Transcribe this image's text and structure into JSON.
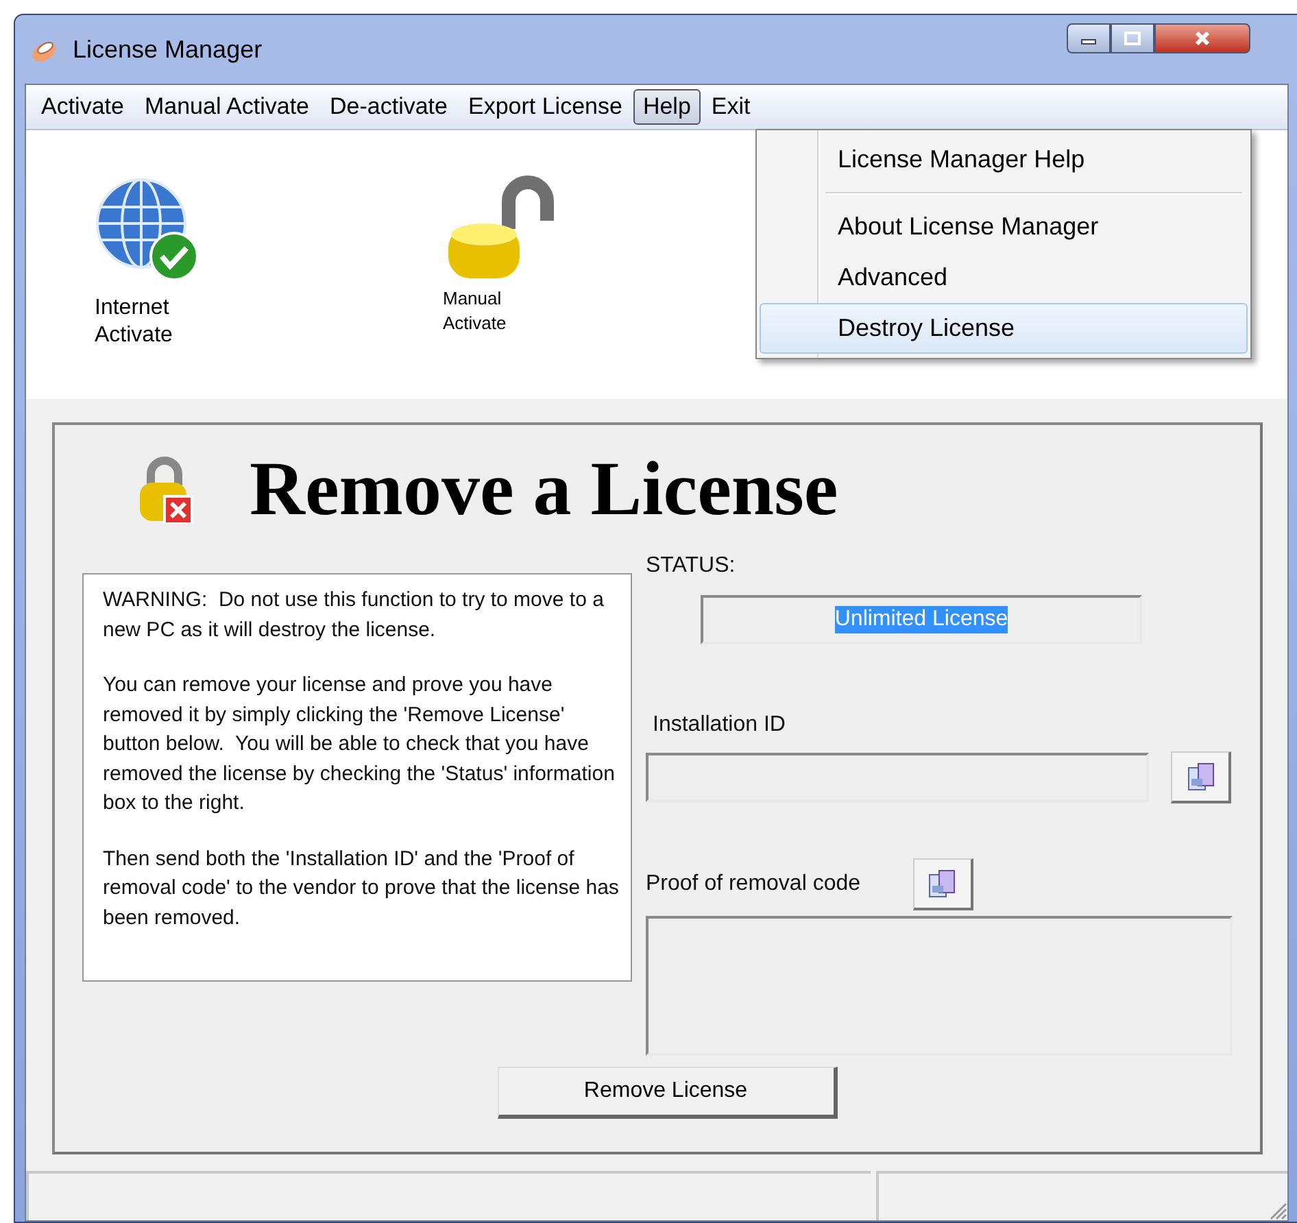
{
  "window": {
    "title": "License Manager"
  },
  "menu": [
    {
      "label": "Activate",
      "open": false
    },
    {
      "label": "Manual Activate",
      "open": false
    },
    {
      "label": "De-activate",
      "open": false
    },
    {
      "label": "Export License",
      "open": false
    },
    {
      "label": "Help",
      "open": true
    },
    {
      "label": "Exit",
      "open": false
    }
  ],
  "help_menu": [
    {
      "kind": "item",
      "label": "License Manager Help",
      "selected": false
    },
    {
      "kind": "separator"
    },
    {
      "kind": "item",
      "label": "About License Manager",
      "selected": false
    },
    {
      "kind": "item",
      "label": "Advanced",
      "selected": false
    },
    {
      "kind": "item",
      "label": "Destroy License",
      "selected": true
    }
  ],
  "toolbar": [
    {
      "kind": "globe",
      "label": "Internet Activate"
    },
    {
      "kind": "padlock",
      "label": "Manual Activate"
    }
  ],
  "panel": {
    "title": "Remove a License",
    "warning": [
      "WARNING:  Do not use this function to try to move to a new PC as it will destroy the license.",
      "You can remove your license and prove you have removed it by simply clicking the 'Remove License' button below.  You will be able to check that you have removed the license by checking the 'Status' information box to the right.",
      "Then send both the 'Installation ID' and the 'Proof of removal code' to the vendor to prove that the license has been removed."
    ],
    "status_label": "STATUS:",
    "status_value": "Unlimited License",
    "status_value_selected": true,
    "installation_label": "Installation ID",
    "proof_label": "Proof of removal code",
    "button": "Remove License"
  }
}
